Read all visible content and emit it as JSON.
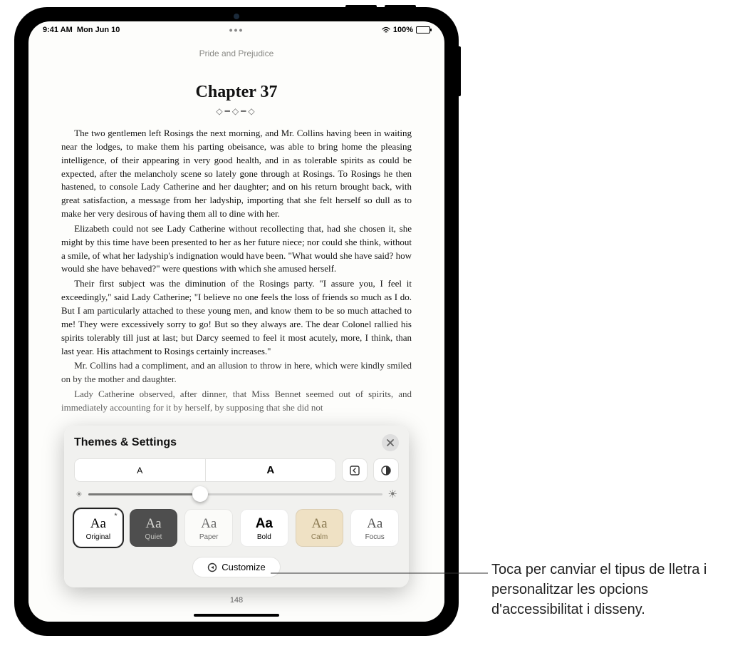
{
  "status": {
    "time": "9:41 AM",
    "date": "Mon Jun 10",
    "battery_pct": "100%"
  },
  "book": {
    "title": "Pride and Prejudice",
    "chapter": "Chapter 37",
    "page_number": "148",
    "paragraphs": [
      "The two gentlemen left Rosings the next morning, and Mr. Collins having been in waiting near the lodges, to make them his parting obeisance, was able to bring home the pleasing intelligence, of their appearing in very good health, and in as tolerable spirits as could be expected, after the melancholy scene so lately gone through at Rosings. To Rosings he then hastened, to console Lady Catherine and her daughter; and on his return brought back, with great satisfaction, a message from her ladyship, importing that she felt herself so dull as to make her very desirous of having them all to dine with her.",
      "Elizabeth could not see Lady Catherine without recollecting that, had she chosen it, she might by this time have been presented to her as her future niece; nor could she think, without a smile, of what her ladyship's indignation would have been. \"What would she have said? how would she have behaved?\" were questions with which she amused herself.",
      "Their first subject was the diminution of the Rosings party. \"I assure you, I feel it exceedingly,\" said Lady Catherine; \"I believe no one feels the loss of friends so much as I do. But I am particularly attached to these young men, and know them to be so much attached to me! They were excessively sorry to go! But so they always are. The dear Colonel rallied his spirits tolerably till just at last; but Darcy seemed to feel it most acutely, more, I think, than last year. His attachment to Rosings certainly increases.\"",
      "Mr. Collins had a compliment, and an allusion to throw in here, which were kindly smiled on by the mother and daughter.",
      "Lady Catherine observed, after dinner, that Miss Bennet seemed out of spirits, and immediately accounting for it by herself, by supposing that she did not"
    ]
  },
  "panel": {
    "title": "Themes & Settings",
    "font_small_label": "A",
    "font_large_label": "A",
    "brightness_value": 38,
    "customize_label": "Customize",
    "themes": [
      {
        "label": "Original",
        "selected": true
      },
      {
        "label": "Quiet",
        "selected": false
      },
      {
        "label": "Paper",
        "selected": false
      },
      {
        "label": "Bold",
        "selected": false
      },
      {
        "label": "Calm",
        "selected": false
      },
      {
        "label": "Focus",
        "selected": false
      }
    ],
    "icons": {
      "close": "close-icon",
      "scroll_toggle": "scroll-direction-icon",
      "dark_mode": "dark-mode-icon",
      "customize": "options-gear-icon"
    }
  },
  "callout": {
    "text": "Toca per canviar el tipus de lletra i personalitzar les opcions d'accessibilitat i disseny."
  }
}
